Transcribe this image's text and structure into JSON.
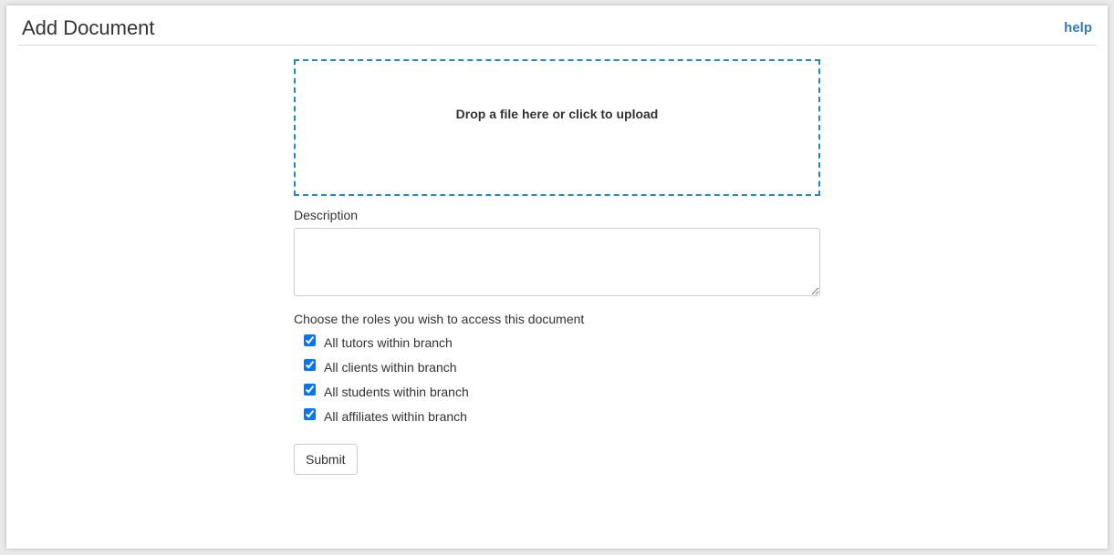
{
  "header": {
    "title": "Add Document",
    "help_label": "help"
  },
  "upload": {
    "label": "Drop a file here or click to upload"
  },
  "description": {
    "label": "Description",
    "value": "",
    "placeholder": ""
  },
  "roles": {
    "label": "Choose the roles you wish to access this document",
    "items": [
      {
        "label": "All tutors within branch",
        "checked": true
      },
      {
        "label": "All clients within branch",
        "checked": true
      },
      {
        "label": "All students within branch",
        "checked": true
      },
      {
        "label": "All affiliates within branch",
        "checked": true
      }
    ]
  },
  "form": {
    "submit_label": "Submit"
  },
  "colors": {
    "link": "#337ab7",
    "dropzone_border": "#1e88d4"
  }
}
